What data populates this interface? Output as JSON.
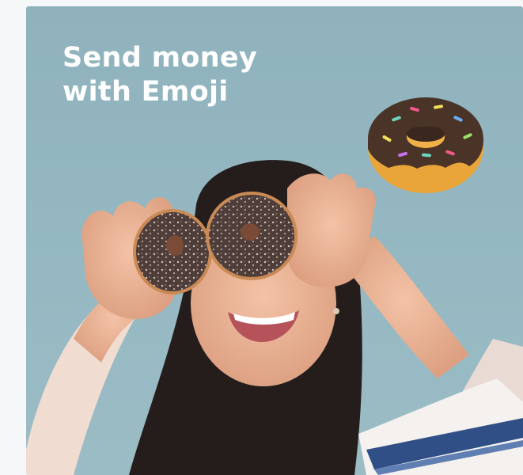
{
  "promo": {
    "headline_line1": "Send money",
    "headline_line2": "with Emoji",
    "emoji": "donut-emoji",
    "background_color": "#93b6c0",
    "accent_chocolate": "#4a3427",
    "accent_dough": "#e9a53a"
  }
}
